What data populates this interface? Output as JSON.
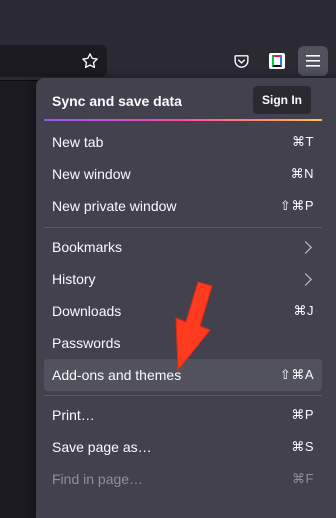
{
  "colors": {
    "page_bg": "#1c1b22",
    "toolbar_bg": "#2b2a33",
    "menu_bg": "#42414d",
    "hover_bg": "#52525e",
    "accent_arrow": "#ff3b1f"
  },
  "toolbar": {
    "icons": [
      "star-icon",
      "pocket-icon",
      "extension-icon",
      "hamburger-menu-icon"
    ]
  },
  "menu": {
    "sync": {
      "title": "Sync and save data",
      "signin_label": "Sign In"
    },
    "items": [
      {
        "label": "New tab",
        "shortcut": "⌘T"
      },
      {
        "label": "New window",
        "shortcut": "⌘N"
      },
      {
        "label": "New private window",
        "shortcut": "⇧⌘P"
      },
      {
        "label": "Bookmarks",
        "shortcut": ""
      },
      {
        "label": "History",
        "shortcut": ""
      },
      {
        "label": "Downloads",
        "shortcut": "⌘J"
      },
      {
        "label": "Passwords",
        "shortcut": ""
      },
      {
        "label": "Add-ons and themes",
        "shortcut": "⇧⌘A"
      },
      {
        "label": "Print…",
        "shortcut": "⌘P"
      },
      {
        "label": "Save page as…",
        "shortcut": "⌘S"
      },
      {
        "label": "Find in page…",
        "shortcut": "⌘F"
      }
    ]
  }
}
